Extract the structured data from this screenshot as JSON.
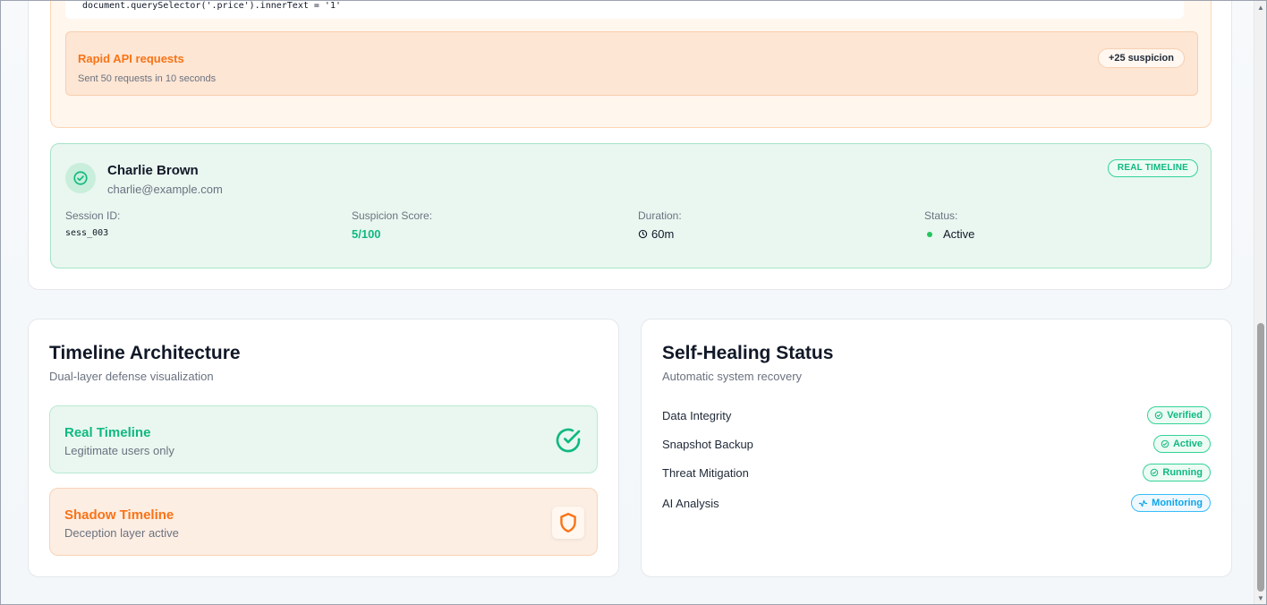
{
  "event_log": {
    "code_snippet": "document.querySelector('.price').innerText = '1'",
    "event": {
      "title": "Rapid API requests",
      "description": "Sent 50 requests in 10 seconds",
      "badge": "+25 suspicion"
    }
  },
  "session": {
    "name": "Charlie Brown",
    "email": "charlie@example.com",
    "timeline_badge": "REAL TIMELINE",
    "session_id_label": "Session ID:",
    "session_id": "sess_003",
    "score_label": "Suspicion Score:",
    "score": "5/100",
    "duration_label": "Duration:",
    "duration": "60m",
    "status_label": "Status:",
    "status": "Active"
  },
  "architecture": {
    "title": "Timeline Architecture",
    "subtitle": "Dual-layer defense visualization",
    "real": {
      "title": "Real Timeline",
      "desc": "Legitimate users only"
    },
    "shadow": {
      "title": "Shadow Timeline",
      "desc": "Deception layer active"
    }
  },
  "healing": {
    "title": "Self-Healing Status",
    "subtitle": "Automatic system recovery",
    "rows": [
      {
        "label": "Data Integrity",
        "status": "Verified"
      },
      {
        "label": "Snapshot Backup",
        "status": "Active"
      },
      {
        "label": "Threat Mitigation",
        "status": "Running"
      },
      {
        "label": "AI Analysis",
        "status": "Monitoring"
      }
    ]
  },
  "colors": {
    "success": "#10b981",
    "warning": "#f97316",
    "info": "#0ea5e9"
  }
}
